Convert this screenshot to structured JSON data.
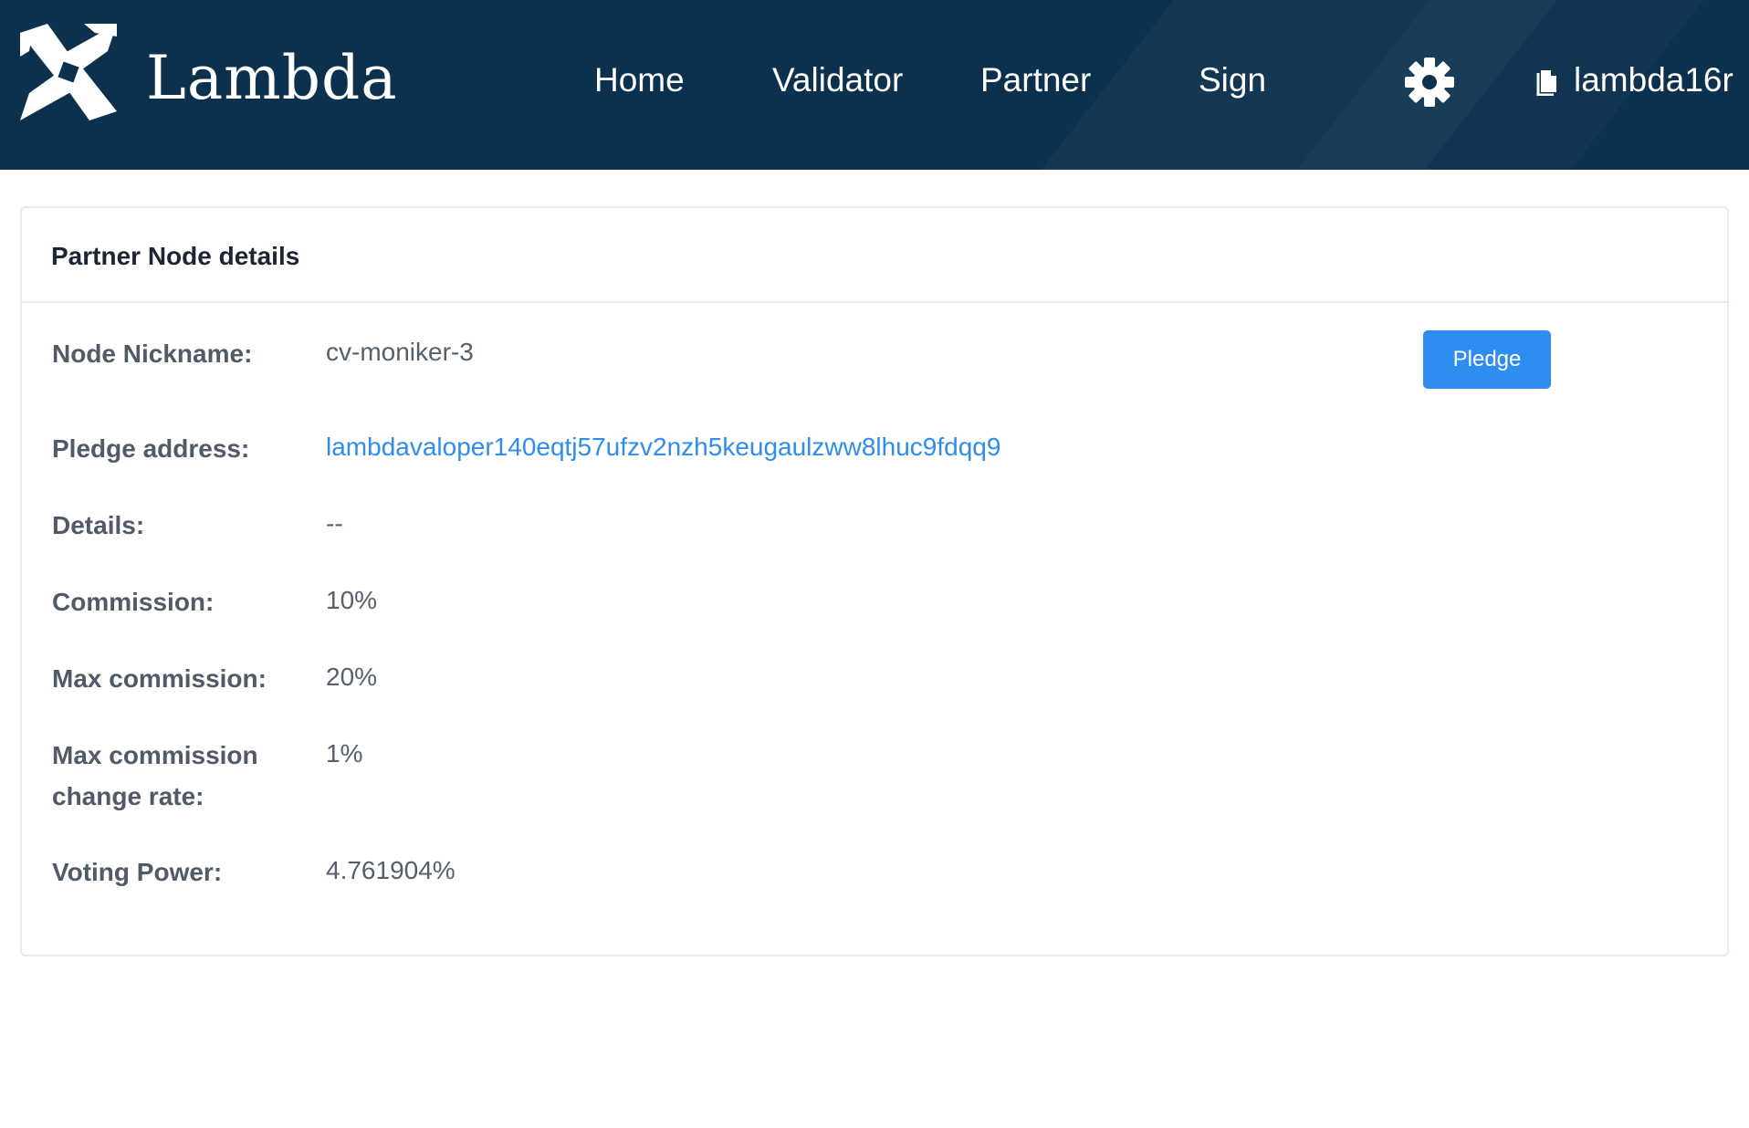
{
  "header": {
    "brand": "Lambda",
    "logo_icon": "lambda-pinwheel-logo",
    "nav": {
      "home": "Home",
      "validator": "Validator",
      "partner": "Partner",
      "sign": "Sign"
    },
    "settings_icon": "gear-icon",
    "account_icon": "document-icon",
    "account_label": "lambda16r"
  },
  "card": {
    "title": "Partner Node details",
    "pledge_button": "Pledge",
    "fields": {
      "nickname": {
        "label": "Node Nickname:",
        "value": "cv-moniker-3"
      },
      "pledge_address": {
        "label": "Pledge address:",
        "value": "lambdavaloper140eqtj57ufzv2nzh5keugaulzww8lhuc9fdqq9"
      },
      "details": {
        "label": "Details:",
        "value": "--"
      },
      "commission": {
        "label": "Commission:",
        "value": "10%"
      },
      "max_commission": {
        "label": "Max commission:",
        "value": "20%"
      },
      "max_change_rate": {
        "label": "Max commission change rate:",
        "value": "1%"
      },
      "voting_power": {
        "label": "Voting Power:",
        "value": "4.761904%"
      }
    }
  },
  "colors": {
    "header_bg": "#0c314e",
    "accent": "#2f8df0",
    "label": "#505a68",
    "value": "#56606d"
  }
}
